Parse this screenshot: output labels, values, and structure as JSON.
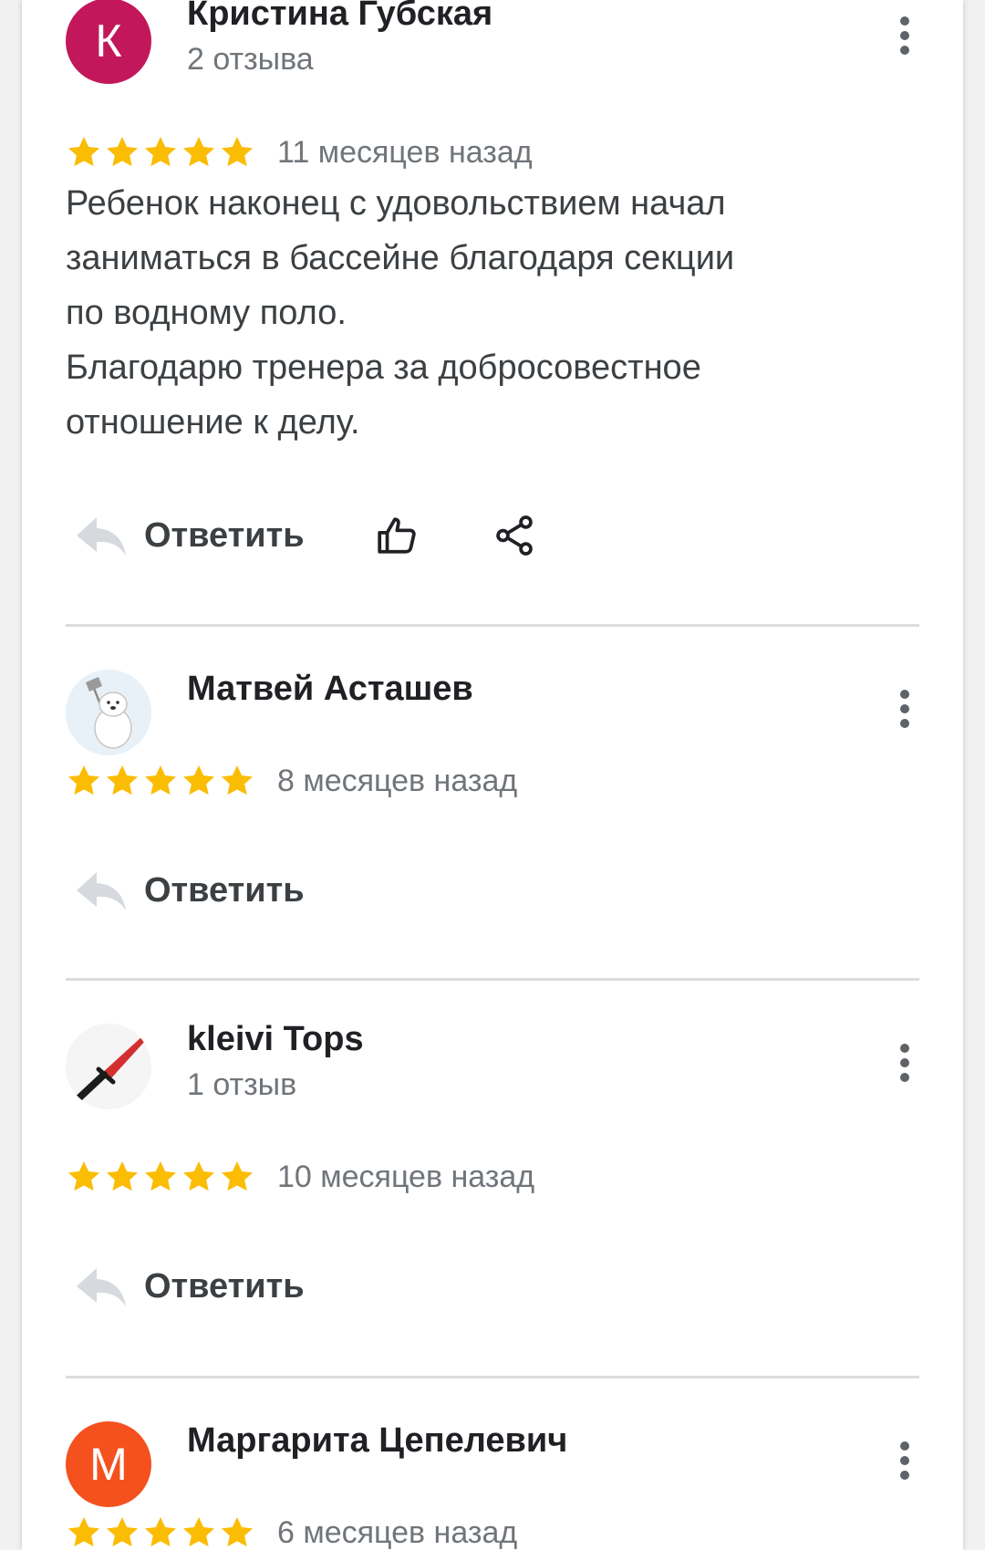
{
  "colors": {
    "star": "#fbbc04",
    "avatar_k": "#c2185b",
    "avatar_m": "#f4511e"
  },
  "reviews": [
    {
      "name": "Кристина Губская",
      "review_count": "2 отзыва",
      "avatar_letter": "К",
      "rating": 5,
      "date": "11 месяцев назад",
      "text": "Ребенок наконец с удовольствием начал\nзаниматься в бассейне благодаря секции\nпо водному поло.\nБлагодарю тренера за добросовестное\nотношение к делу.",
      "reply_label": "Ответить"
    },
    {
      "name": "Матвей Асташев",
      "rating": 5,
      "date": "8 месяцев назад",
      "reply_label": "Ответить"
    },
    {
      "name": "kleivi Tops",
      "review_count": "1 отзыв",
      "rating": 5,
      "date": "10 месяцев назад",
      "reply_label": "Ответить"
    },
    {
      "name": "Маргарита Цепелевич",
      "avatar_letter": "М",
      "rating": 5,
      "date": "6 месяцев назад"
    }
  ]
}
